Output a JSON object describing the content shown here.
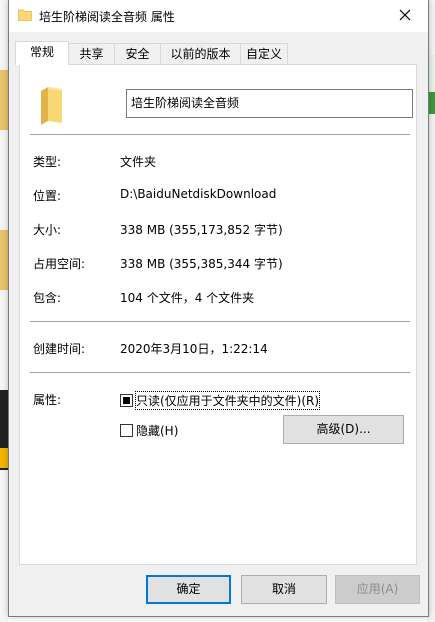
{
  "window": {
    "title": "培生阶梯阅读全音频 属性",
    "close_symbol": "✕"
  },
  "tabs": [
    {
      "label": "常规",
      "active": true
    },
    {
      "label": "共享",
      "active": false
    },
    {
      "label": "安全",
      "active": false
    },
    {
      "label": "以前的版本",
      "active": false
    },
    {
      "label": "自定义",
      "active": false
    }
  ],
  "general": {
    "folder_name": "培生阶梯阅读全音频",
    "type_label": "类型:",
    "type_value": "文件夹",
    "location_label": "位置:",
    "location_value": "D:\\BaiduNetdiskDownload",
    "size_label": "大小:",
    "size_value": "338 MB (355,173,852 字节)",
    "disk_label": "占用空间:",
    "disk_value": "338 MB (355,385,344 字节)",
    "contains_label": "包含:",
    "contains_value": "104 个文件，4 个文件夹",
    "created_label": "创建时间:",
    "created_value": "2020年3月10日，1:22:14",
    "attributes_label": "属性:",
    "readonly_label": "只读(仅应用于文件夹中的文件)(R)",
    "readonly_state": "indeterminate",
    "hidden_label": "隐藏(H)",
    "hidden_checked": false,
    "advanced_button": "高级(D)..."
  },
  "footer": {
    "ok": "确定",
    "cancel": "取消",
    "apply": "应用(A)"
  },
  "colors": {
    "dialog_bg": "#f0f0f0",
    "panel_bg": "#ffffff",
    "focus_border": "#0078d7",
    "folder_yellow": "#f8d775",
    "folder_dark": "#e0b447"
  }
}
